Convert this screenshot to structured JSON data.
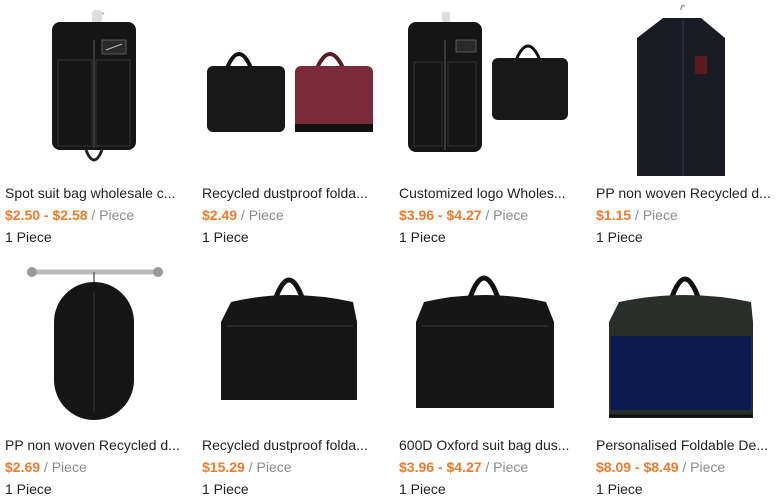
{
  "products": [
    {
      "title": "Spot suit bag wholesale c...",
      "price": "$2.50 - $2.58",
      "unit": " / Piece",
      "moq": "1 Piece"
    },
    {
      "title": "Recycled dustproof folda...",
      "price": "$2.49",
      "unit": " / Piece",
      "moq": "1 Piece"
    },
    {
      "title": "Customized logo Wholes...",
      "price": "$3.96 - $4.27",
      "unit": " / Piece",
      "moq": "1 Piece"
    },
    {
      "title": "PP non woven Recycled d...",
      "price": "$1.15",
      "unit": " / Piece",
      "moq": "1 Piece"
    },
    {
      "title": "PP non woven Recycled d...",
      "price": "$2.69",
      "unit": " / Piece",
      "moq": "1 Piece"
    },
    {
      "title": "Recycled dustproof folda...",
      "price": "$15.29",
      "unit": " / Piece",
      "moq": "1 Piece"
    },
    {
      "title": "600D Oxford suit bag dus...",
      "price": "$3.96 - $4.27",
      "unit": " / Piece",
      "moq": "1 Piece"
    },
    {
      "title": "Personalised Foldable De...",
      "price": "$8.09 - $8.49",
      "unit": " / Piece",
      "moq": "1 Piece"
    }
  ],
  "colors": {
    "price": "#f07a2b",
    "unit": "#8a8a8a",
    "text": "#222222"
  }
}
